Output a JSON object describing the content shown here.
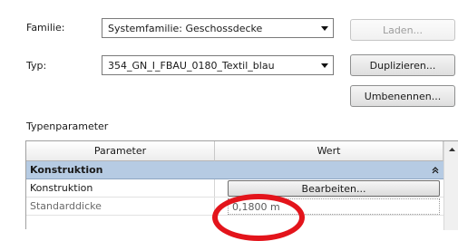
{
  "familie": {
    "label": "Familie:",
    "value": "Systemfamilie: Geschossdecke",
    "load_button": "Laden..."
  },
  "typ": {
    "label": "Typ:",
    "value": "354_GN_I_FBAU_0180_Textil_blau",
    "duplicate_button": "Duplizieren...",
    "rename_button": "Umbenennen..."
  },
  "typeparams": {
    "section_label": "Typenparameter",
    "columns": {
      "parameter": "Parameter",
      "value": "Wert"
    },
    "group": {
      "label": "Konstruktion"
    },
    "rows": [
      {
        "name": "Konstruktion",
        "value": "Bearbeiten..."
      },
      {
        "name": "Standarddicke",
        "value": "0,1800 m"
      }
    ]
  },
  "colors": {
    "group_header_bg": "#b6cbe3",
    "annotation_red": "#e3141b"
  }
}
